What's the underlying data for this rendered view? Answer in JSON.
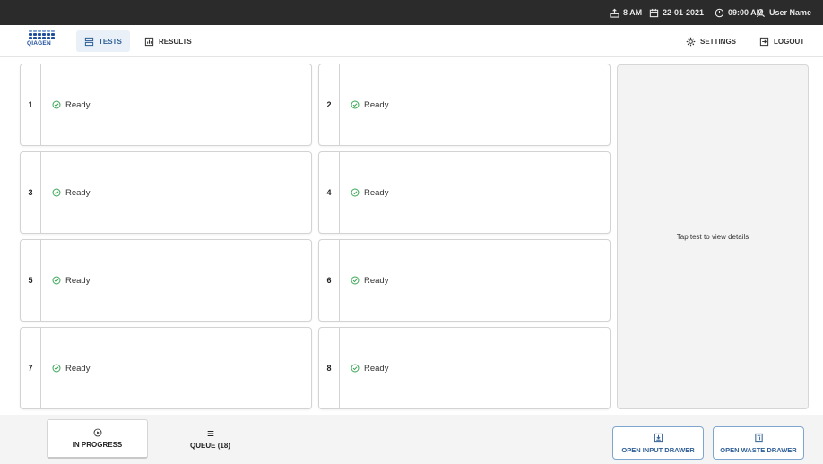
{
  "status_bar": {
    "network": "8 AM",
    "date": "22-01-2021",
    "time": "09:00 AM",
    "user": "User Name"
  },
  "nav": {
    "brand": "QIAGEN",
    "tests_label": "TESTS",
    "results_label": "RESULTS",
    "settings_label": "SETTINGS",
    "logout_label": "LOGOUT"
  },
  "slots": [
    {
      "number": "1",
      "status": "Ready"
    },
    {
      "number": "2",
      "status": "Ready"
    },
    {
      "number": "3",
      "status": "Ready"
    },
    {
      "number": "4",
      "status": "Ready"
    },
    {
      "number": "5",
      "status": "Ready"
    },
    {
      "number": "6",
      "status": "Ready"
    },
    {
      "number": "7",
      "status": "Ready"
    },
    {
      "number": "8",
      "status": "Ready"
    }
  ],
  "detail_panel": {
    "hint": "Tap test to view details"
  },
  "bottom": {
    "in_progress_label": "IN PROGRESS",
    "queue_label": "QUEUE (18)",
    "open_input_label": "OPEN INPUT DRAWER",
    "open_waste_label": "OPEN WASTE DRAWER"
  },
  "colors": {
    "status_bar_bg": "#2b2b2b",
    "accent_blue": "#2f5f96",
    "ready_green": "#3aa655"
  }
}
